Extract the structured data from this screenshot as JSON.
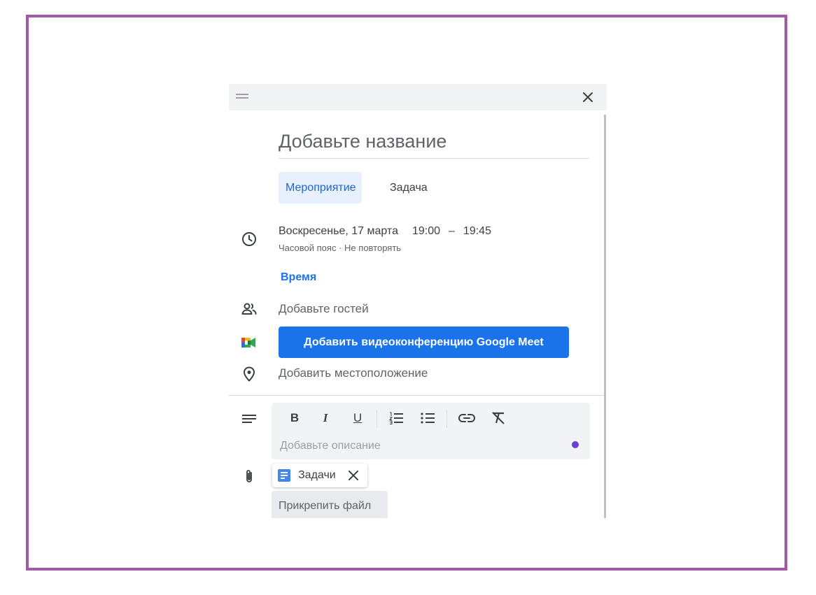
{
  "dialog": {
    "close_icon": "close-icon",
    "drag_icon": "drag-handle-icon"
  },
  "title": {
    "placeholder": "Добавьте название"
  },
  "tabs": [
    {
      "label": "Мероприятие",
      "selected": true
    },
    {
      "label": "Задача",
      "selected": false
    }
  ],
  "datetime": {
    "date": "Воскресенье, 17 марта",
    "start": "19:00",
    "dash": "–",
    "end": "19:45",
    "timezone": "Часовой пояс",
    "separator": "·",
    "repeat": "Не повторять",
    "time_link": "Время"
  },
  "guests": {
    "label": "Добавьте гостей"
  },
  "meet": {
    "label": "Добавить видеоконференцию Google Meet"
  },
  "location": {
    "label": "Добавить местоположение"
  },
  "description": {
    "placeholder": "Добавьте описание",
    "toolbar": [
      "bold-icon",
      "italic-icon",
      "underline-icon",
      "numbered-list-icon",
      "bulleted-list-icon",
      "link-icon",
      "clear-formatting-icon"
    ]
  },
  "attachments": {
    "items": [
      {
        "name": "Задачи"
      }
    ],
    "attach_label": "Прикрепить файл"
  },
  "colors": {
    "accent": "#1a73e8",
    "frame": "#a05aa8",
    "tab_selected_bg": "#e8f0fe",
    "dot": "#6c3fd9"
  }
}
